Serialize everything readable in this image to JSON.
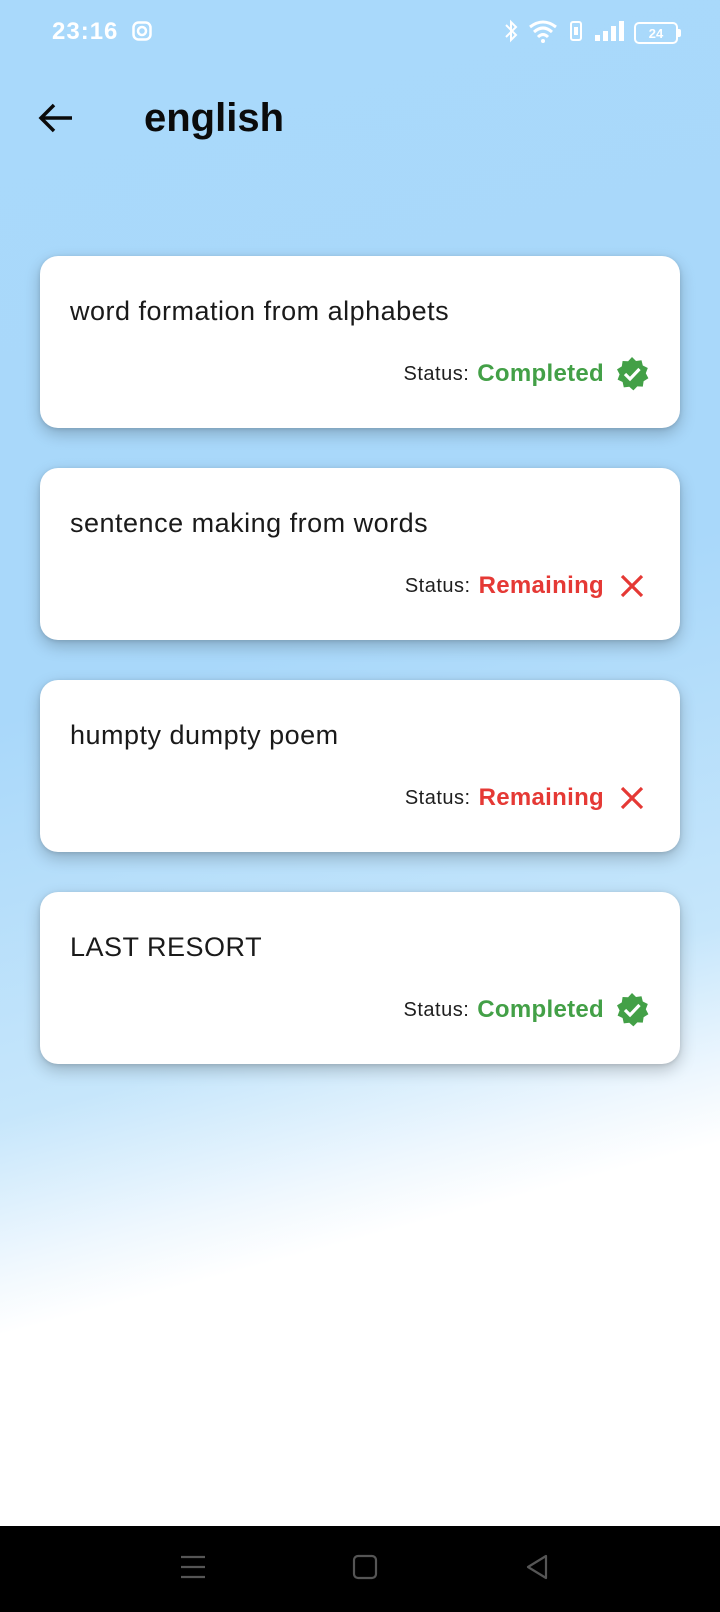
{
  "status_bar": {
    "time": "23:16",
    "battery_level": "24",
    "icons": [
      "instagram-icon",
      "bluetooth-icon",
      "wifi-icon",
      "vibrate-icon",
      "signal-icon",
      "battery-icon"
    ]
  },
  "header": {
    "title": "english",
    "back_icon": "arrow-left-icon"
  },
  "lessons": [
    {
      "title": "word formation from alphabets",
      "status_label": "Status:",
      "status": "Completed",
      "status_icon": "verified-check-icon"
    },
    {
      "title": "sentence making from words",
      "status_label": "Status:",
      "status": "Remaining",
      "status_icon": "close-x-icon"
    },
    {
      "title": "humpty dumpty poem",
      "status_label": "Status:",
      "status": "Remaining",
      "status_icon": "close-x-icon"
    },
    {
      "title": "LAST RESORT",
      "status_label": "Status:",
      "status": "Completed",
      "status_icon": "verified-check-icon"
    }
  ],
  "colors": {
    "completed": "#43a047",
    "remaining": "#e53935",
    "header_bg": "#a9d9fb"
  },
  "nav_bar": {
    "icons": [
      "menu-icon",
      "home-square-icon",
      "back-triangle-icon"
    ]
  }
}
